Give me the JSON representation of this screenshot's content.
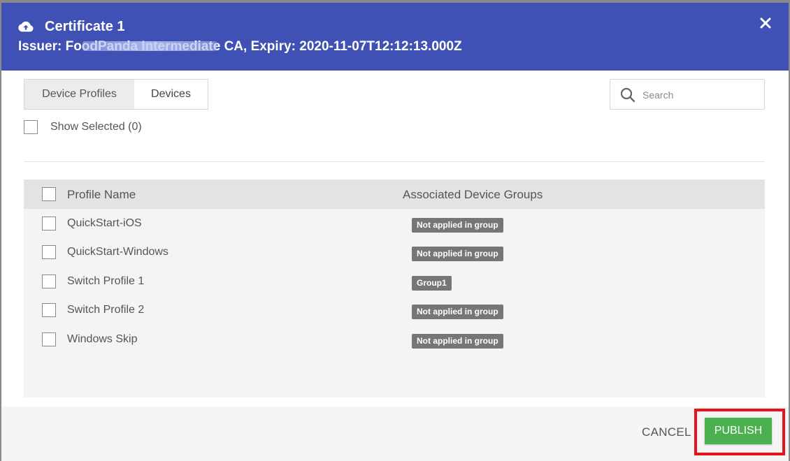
{
  "header": {
    "title": "Certificate 1",
    "subtitle": "Issuer: FoodPanda Intermediate CA, Expiry: 2020-11-07T12:12:13.000Z",
    "icon": "cloud-upload-icon",
    "close_icon": "close-icon",
    "background_color": "#3f51b5"
  },
  "tabs": [
    {
      "label": "Device Profiles",
      "active": true
    },
    {
      "label": "Devices",
      "active": false
    }
  ],
  "search": {
    "placeholder": "Search",
    "value": "",
    "icon": "search-icon"
  },
  "show_selected": {
    "label": "Show Selected (0)",
    "checked": false
  },
  "table": {
    "columns": [
      "Profile Name",
      "Associated Device Groups"
    ],
    "rows": [
      {
        "name": "QuickStart-iOS",
        "group": "Not applied in group",
        "checked": false
      },
      {
        "name": "QuickStart-Windows",
        "group": "Not applied in group",
        "checked": false
      },
      {
        "name": "Switch Profile 1",
        "group": "Group1",
        "checked": false
      },
      {
        "name": "Switch Profile 2",
        "group": "Not applied in group",
        "checked": false
      },
      {
        "name": "Windows Skip",
        "group": "Not applied in group",
        "checked": false
      }
    ]
  },
  "footer": {
    "cancel_label": "CANCEL",
    "publish_label": "PUBLISH",
    "publish_color": "#4caf50",
    "highlight_color": "#e8121b"
  }
}
